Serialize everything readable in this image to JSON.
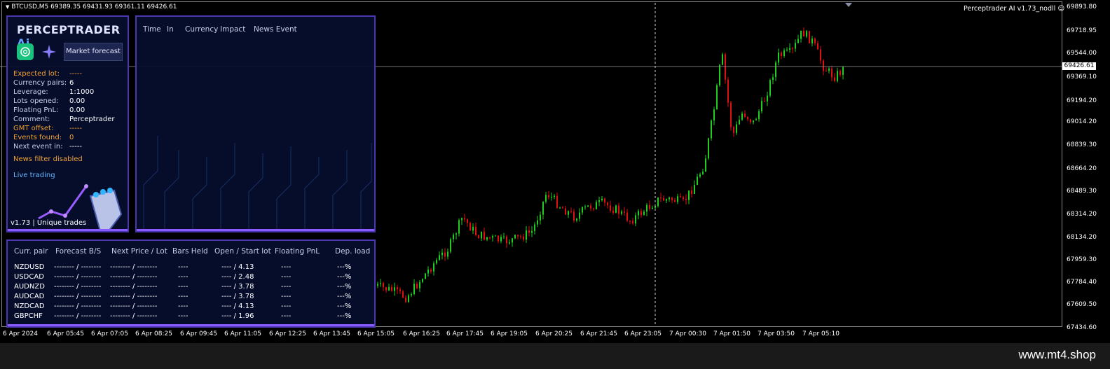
{
  "chart": {
    "symbol_line": "BTCUSD,M5  69389.35 69431.93 69361.11 69426.61",
    "ea_label": "Perceptrader AI  v1.73_nodll",
    "current_price": "69426.61",
    "price_ticks": [
      "69893.80",
      "69718.95",
      "69544.00",
      "69369.10",
      "69194.20",
      "69014.20",
      "68839.30",
      "68664.20",
      "68489.30",
      "68314.20",
      "68134.20",
      "67959.30",
      "67784.40",
      "67609.50",
      "67434.60"
    ],
    "time_ticks": [
      "6 Apr 2024",
      "6 Apr 05:45",
      "6 Apr 07:05",
      "6 Apr 08:25",
      "6 Apr 09:45",
      "6 Apr 11:05",
      "6 Apr 12:25",
      "6 Apr 13:45",
      "6 Apr 15:05",
      "6 Apr 16:25",
      "6 Apr 17:45",
      "6 Apr 19:05",
      "6 Apr 20:25",
      "6 Apr 21:45",
      "6 Apr 23:05",
      "7 Apr 00:30",
      "7 Apr 01:50",
      "7 Apr 03:50",
      "7 Apr 05:10"
    ],
    "up_color": "#22cc22",
    "down_color": "#dd1111"
  },
  "panel": {
    "logo_main": "PERCEPTRADER",
    "logo_ai": "Ai",
    "market_forecast_button": "Market forecast",
    "stats": [
      {
        "label": "Expected lot:",
        "value": "-----",
        "warn": true
      },
      {
        "label": "Currency pairs:",
        "value": "6",
        "warn": false
      },
      {
        "label": "Leverage:",
        "value": "1:1000",
        "warn": false
      },
      {
        "label": "Lots opened:",
        "value": "0.00",
        "warn": false
      },
      {
        "label": "Floating PnL:",
        "value": "0.00",
        "warn": false
      },
      {
        "label": "Comment:",
        "value": "Perceptrader",
        "warn": false
      },
      {
        "label": "GMT offset:",
        "value": "-----",
        "warn": true
      },
      {
        "label": "Events found:",
        "value": "0",
        "warn": true
      },
      {
        "label": "Next event in:",
        "value": "-----",
        "warn": false
      }
    ],
    "news_filter": "News filter disabled",
    "live_trading": "Live trading",
    "version": "v1.73 | Unique trades"
  },
  "news": {
    "headers": [
      "Time",
      "In",
      "Currency",
      "Impact",
      "News Event"
    ]
  },
  "table": {
    "headers": [
      "Curr. pair",
      "Forecast B/S",
      "Next Price / Lot",
      "Bars Held",
      "Open / Start lot",
      "Floating PnL",
      "Dep. load"
    ],
    "rows": [
      [
        "NZDUSD",
        "-------- / --------",
        "-------- / --------",
        "----",
        "---- / 4.13",
        "----",
        "---%"
      ],
      [
        "USDCAD",
        "-------- / --------",
        "-------- / --------",
        "----",
        "---- / 2.48",
        "----",
        "---%"
      ],
      [
        "AUDNZD",
        "-------- / --------",
        "-------- / --------",
        "----",
        "---- / 3.78",
        "----",
        "---%"
      ],
      [
        "AUDCAD",
        "-------- / --------",
        "-------- / --------",
        "----",
        "---- / 3.78",
        "----",
        "---%"
      ],
      [
        "NZDCAD",
        "-------- / --------",
        "-------- / --------",
        "----",
        "---- / 4.13",
        "----",
        "---%"
      ],
      [
        "GBPCHF",
        "-------- / --------",
        "-------- / --------",
        "----",
        "---- / 1.96",
        "----",
        "---%"
      ]
    ]
  },
  "footer": {
    "site": "www.mt4.shop"
  }
}
